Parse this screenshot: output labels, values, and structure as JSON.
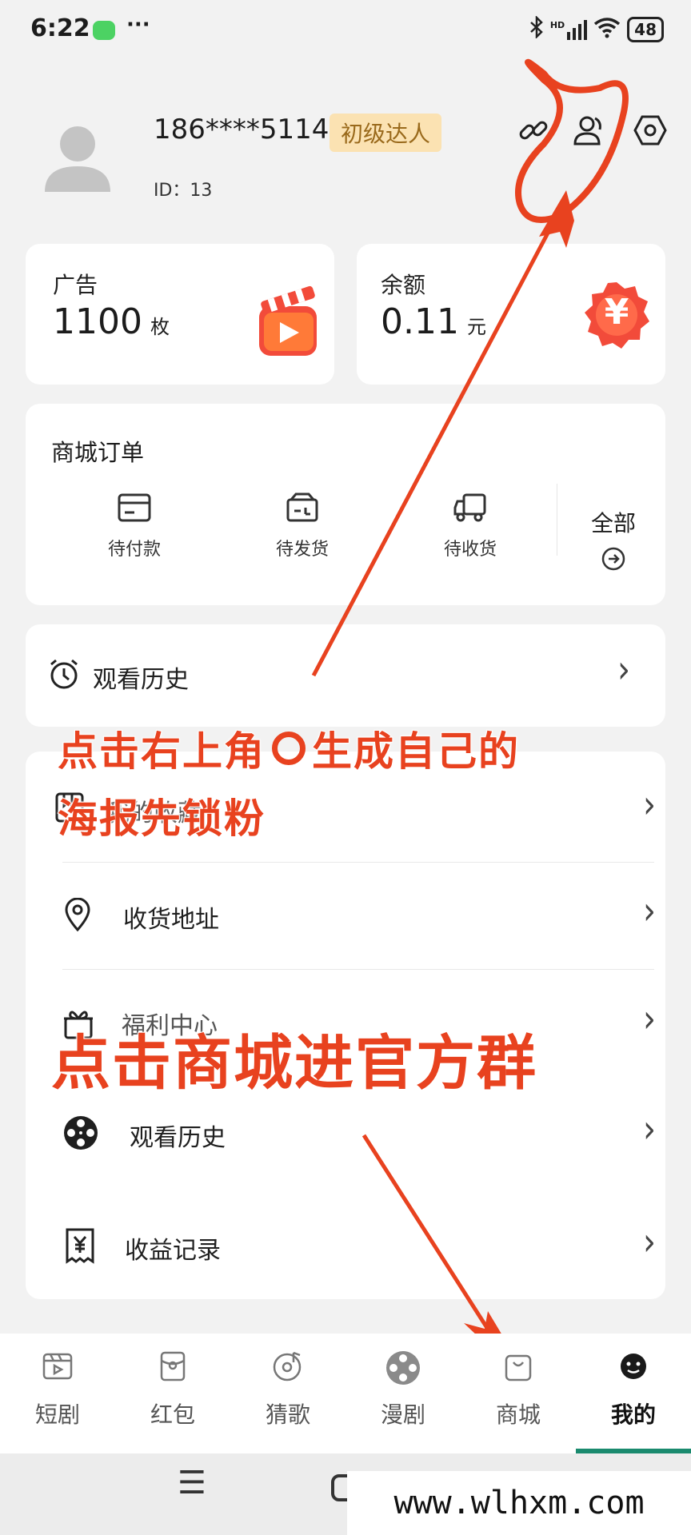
{
  "status_bar": {
    "time": "6:22",
    "dots": "···",
    "signal_text": "HD",
    "battery": "48"
  },
  "profile": {
    "phone": "186****5114",
    "level_badge": "初级达人",
    "id_text": "ID：13"
  },
  "stats": {
    "ads": {
      "label": "广告",
      "value": "1100",
      "unit": "枚"
    },
    "balance": {
      "label": "余额",
      "value": "0.11",
      "unit": "元",
      "icon_glyph": "¥"
    }
  },
  "orders": {
    "title": "商城订单",
    "items": [
      {
        "label": "待付款"
      },
      {
        "label": "待发货"
      },
      {
        "label": "待收货"
      }
    ],
    "all_label": "全部"
  },
  "history_card": {
    "label": "观看历史"
  },
  "menu": {
    "items": [
      {
        "label": "我的收藏"
      },
      {
        "label": "收货地址"
      },
      {
        "label": "福利中心"
      },
      {
        "label": "观看历史"
      },
      {
        "label": "收益记录"
      }
    ]
  },
  "annotations": {
    "top_line1": "点击右上角",
    "top_line1b": "生成自己的",
    "top_line2": "海报先锁粉",
    "bottom": "点击商城进官方群",
    "color": "#e8421f"
  },
  "tabbar": {
    "tabs": [
      {
        "label": "短剧"
      },
      {
        "label": "红包"
      },
      {
        "label": "猜歌"
      },
      {
        "label": "漫剧"
      },
      {
        "label": "商城"
      },
      {
        "label": "我的"
      }
    ],
    "active_color": "#1a8a6e"
  },
  "sysnav": {
    "menu_glyph": "☰"
  },
  "watermark": {
    "text": "www.wlhxm.com"
  }
}
